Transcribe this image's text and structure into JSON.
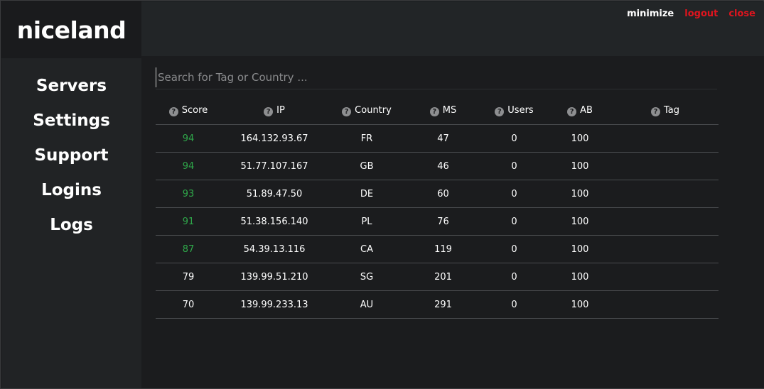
{
  "app": {
    "logo": "niceland"
  },
  "sidebar": {
    "items": [
      {
        "label": "Servers"
      },
      {
        "label": "Settings"
      },
      {
        "label": "Support"
      },
      {
        "label": "Logins"
      },
      {
        "label": "Logs"
      }
    ]
  },
  "window_controls": {
    "minimize": "minimize",
    "logout": "logout",
    "close": "close"
  },
  "search": {
    "placeholder": "Search for Tag or Country ..."
  },
  "table": {
    "headers": [
      "Score",
      "IP",
      "Country",
      "MS",
      "Users",
      "AB",
      "Tag"
    ],
    "rows": [
      {
        "score": "94",
        "ip": "164.132.93.67",
        "country": "FR",
        "ms": "47",
        "users": "0",
        "ab": "100",
        "tag": ""
      },
      {
        "score": "94",
        "ip": "51.77.107.167",
        "country": "GB",
        "ms": "46",
        "users": "0",
        "ab": "100",
        "tag": ""
      },
      {
        "score": "93",
        "ip": "51.89.47.50",
        "country": "DE",
        "ms": "60",
        "users": "0",
        "ab": "100",
        "tag": ""
      },
      {
        "score": "91",
        "ip": "51.38.156.140",
        "country": "PL",
        "ms": "76",
        "users": "0",
        "ab": "100",
        "tag": ""
      },
      {
        "score": "87",
        "ip": "54.39.13.116",
        "country": "CA",
        "ms": "119",
        "users": "0",
        "ab": "100",
        "tag": ""
      },
      {
        "score": "79",
        "ip": "139.99.51.210",
        "country": "SG",
        "ms": "201",
        "users": "0",
        "ab": "100",
        "tag": ""
      },
      {
        "score": "70",
        "ip": "139.99.233.13",
        "country": "AU",
        "ms": "291",
        "users": "0",
        "ab": "100",
        "tag": ""
      }
    ]
  },
  "colors": {
    "score_high": "#2fa84a",
    "accent_red": "#e0141e"
  }
}
